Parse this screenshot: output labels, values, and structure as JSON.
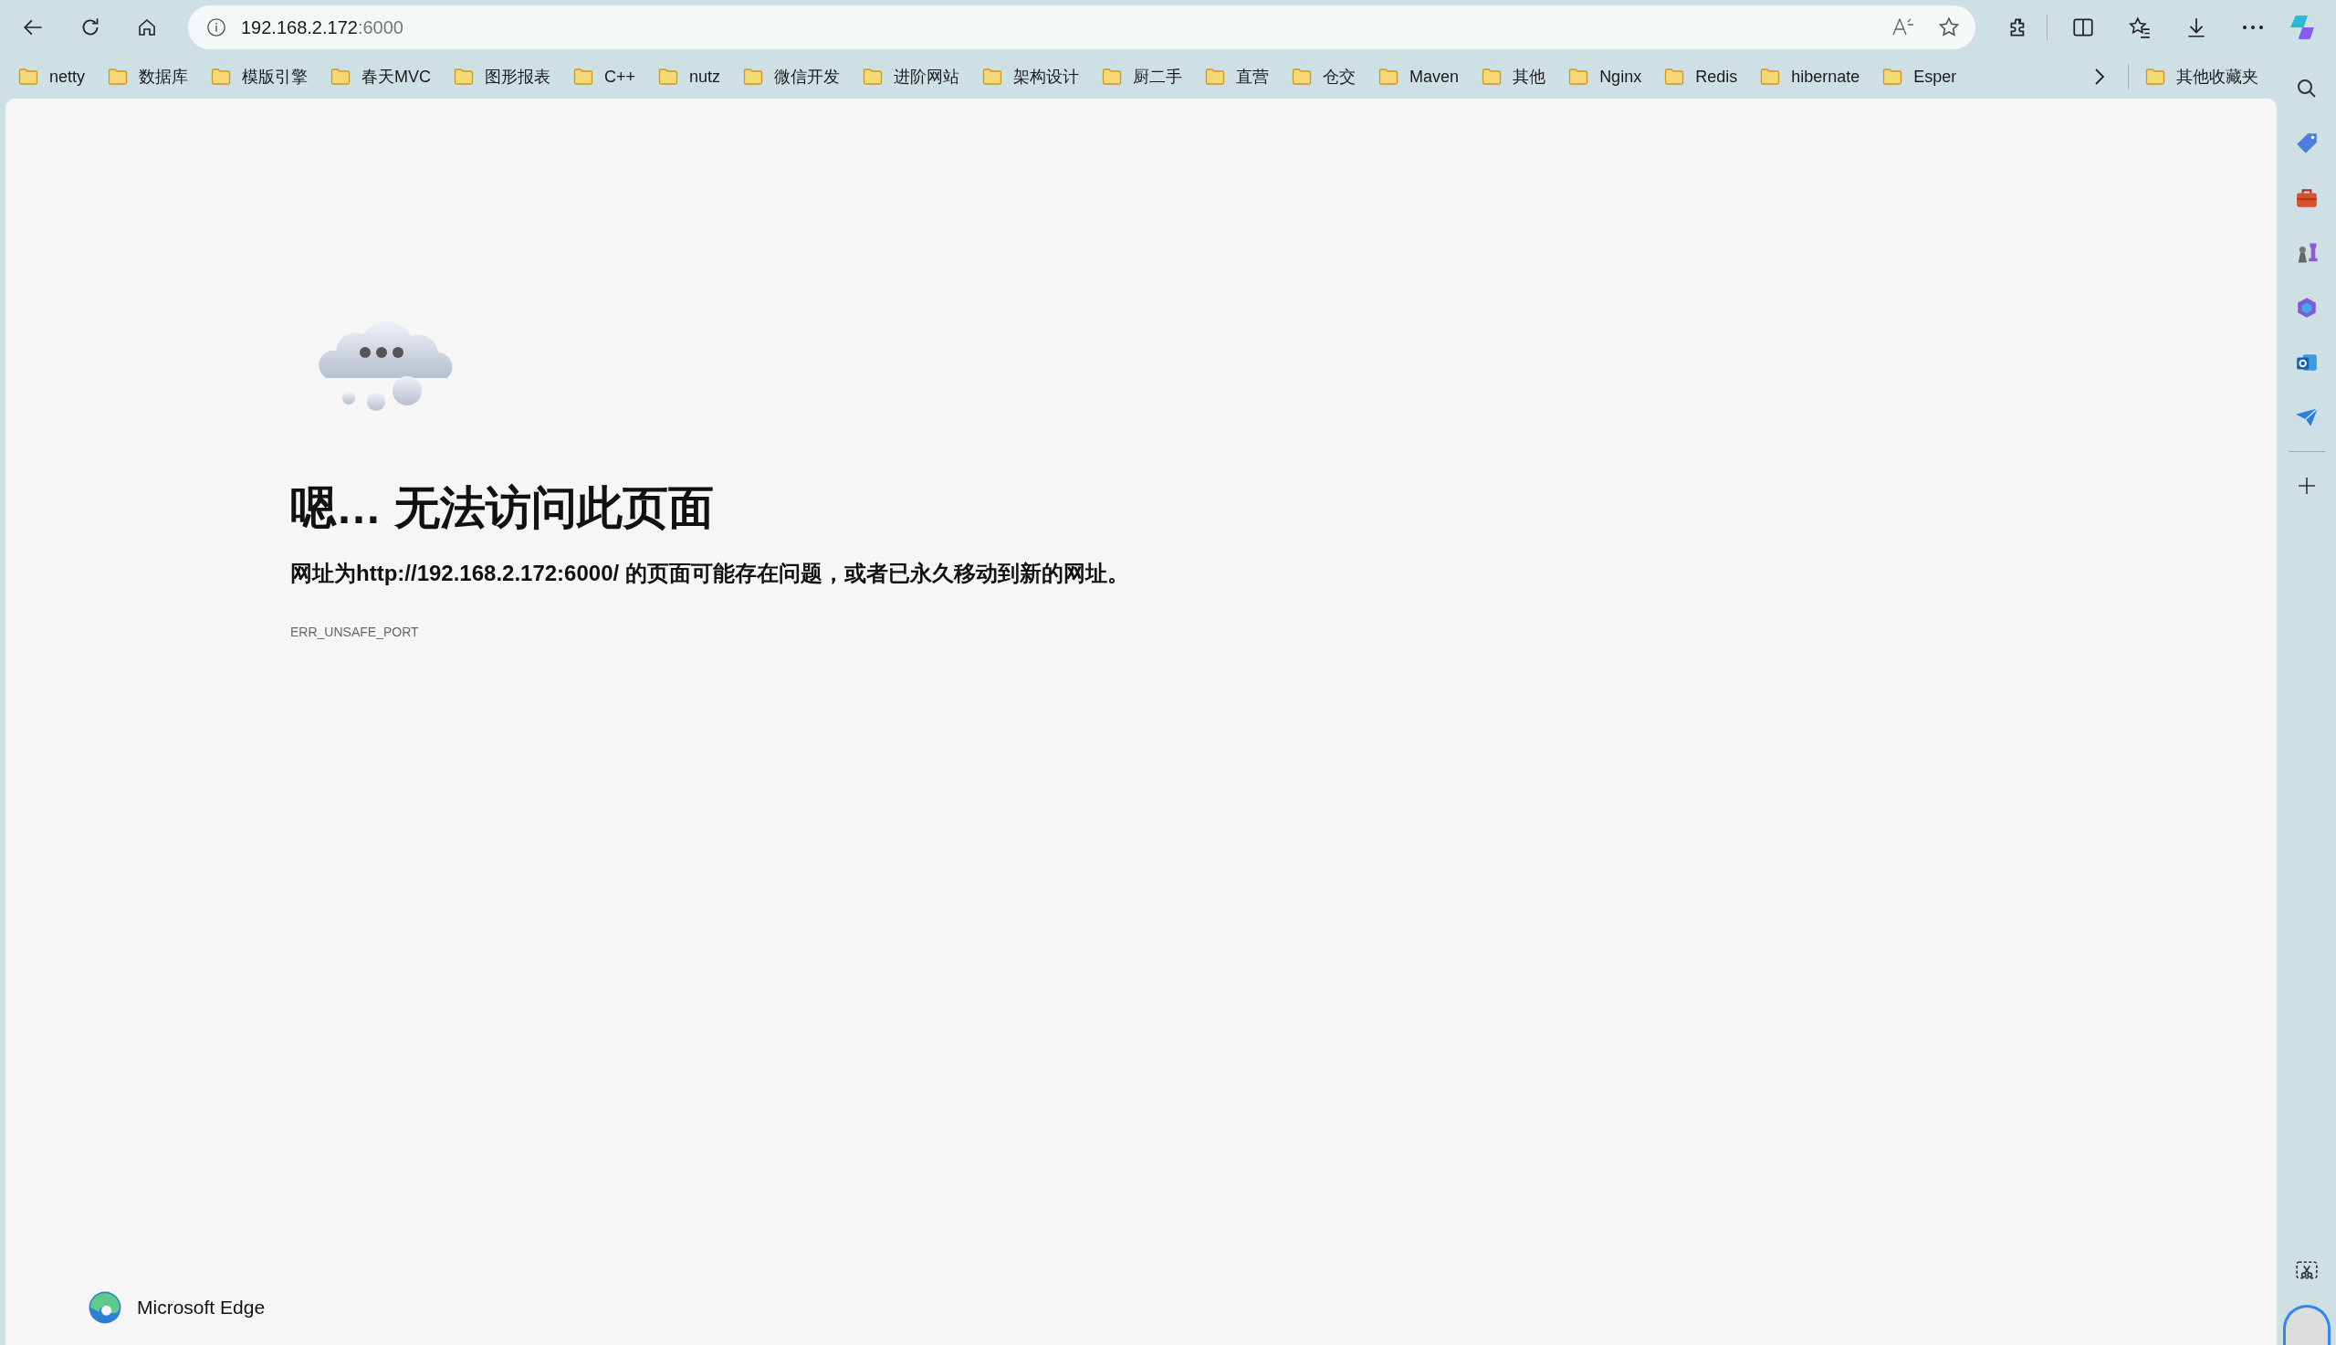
{
  "address_bar": {
    "host": "192.168.2.172",
    "port": ":6000"
  },
  "bookmarks": [
    {
      "label": "netty"
    },
    {
      "label": "数据库"
    },
    {
      "label": "模版引擎"
    },
    {
      "label": "春天MVC"
    },
    {
      "label": "图形报表"
    },
    {
      "label": "C++"
    },
    {
      "label": "nutz"
    },
    {
      "label": "微信开发"
    },
    {
      "label": "进阶网站"
    },
    {
      "label": "架构设计"
    },
    {
      "label": "厨二手"
    },
    {
      "label": "直营"
    },
    {
      "label": "仓交"
    },
    {
      "label": "Maven"
    },
    {
      "label": "其他"
    },
    {
      "label": "Nginx"
    },
    {
      "label": "Redis"
    },
    {
      "label": "hibernate"
    },
    {
      "label": "Esper"
    }
  ],
  "other_favorites": {
    "label": "其他收藏夹"
  },
  "error_page": {
    "title": "嗯… 无法访问此页面",
    "message": "网址为http://192.168.2.172:6000/ 的页面可能存在问题，或者已永久移动到新的网址。",
    "code": "ERR_UNSAFE_PORT"
  },
  "footer": {
    "brand": "Microsoft Edge"
  }
}
